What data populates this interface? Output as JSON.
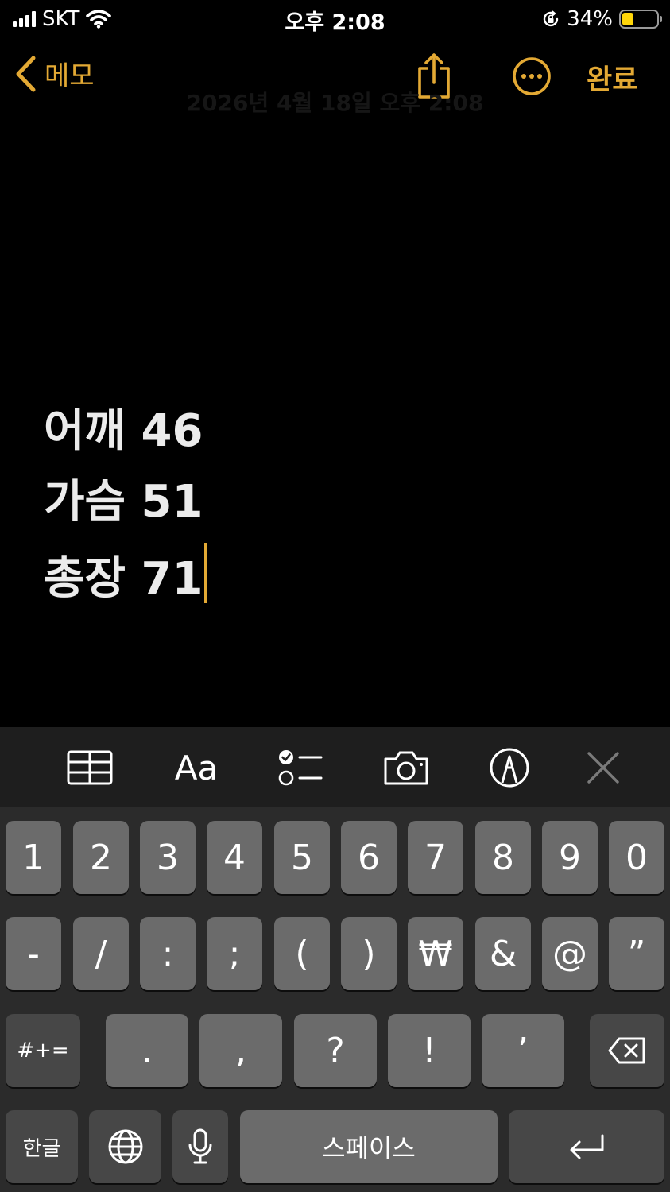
{
  "status_bar": {
    "carrier": "SKT",
    "time": "오후 2:08",
    "battery_percent": "34%",
    "battery_level": 0.34
  },
  "nav": {
    "back_label": "메모",
    "done_label": "완료",
    "date_faint": "2026년 4월 18일 오후 2:08"
  },
  "note": {
    "lines": [
      "어깨 46",
      "가슴 51",
      "총장 71"
    ]
  },
  "toolbar": {
    "aa_label": "Aa"
  },
  "keyboard": {
    "row1": [
      "1",
      "2",
      "3",
      "4",
      "5",
      "6",
      "7",
      "8",
      "9",
      "0"
    ],
    "row2": [
      "-",
      "/",
      ":",
      ";",
      "(",
      ")",
      "₩",
      "&",
      "@",
      "”"
    ],
    "row3_symbols_key": "#+=",
    "row3": [
      ".",
      ",",
      "?",
      "!",
      "’"
    ],
    "lang_key": "한글",
    "space_key": "스페이스"
  },
  "colors": {
    "accent": "#e3a934",
    "background": "#000000",
    "key": "#6b6b6b",
    "key_dark": "#474747",
    "toolbar": "#1e1e1e"
  }
}
